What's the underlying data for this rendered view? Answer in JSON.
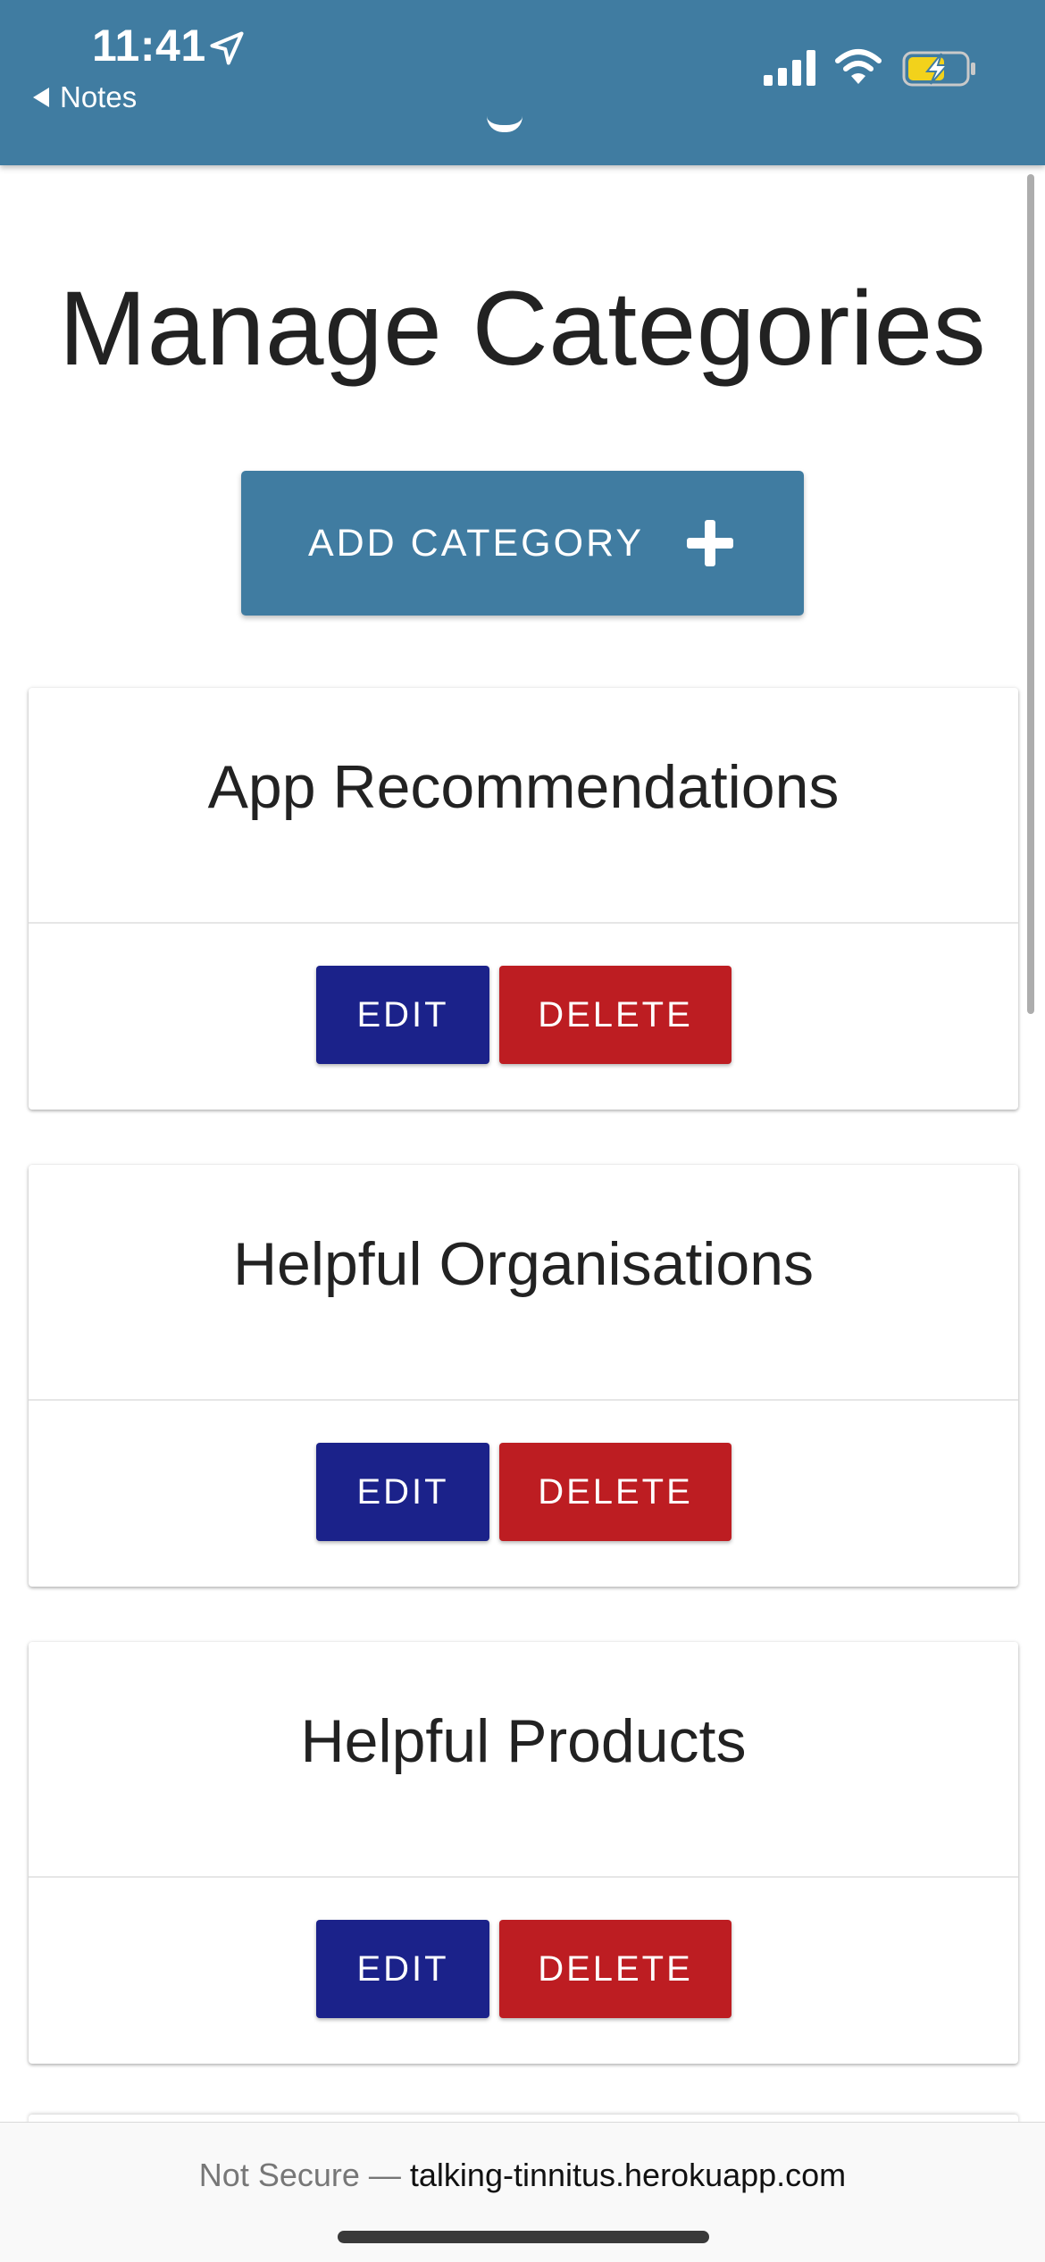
{
  "status_bar": {
    "time": "11:41",
    "back_app": "Notes",
    "icons": [
      "location-arrow-icon",
      "cellular-signal-icon",
      "wifi-icon",
      "battery-charging-icon"
    ]
  },
  "colors": {
    "header": "#407ca1",
    "add_button": "#407ca1",
    "edit_button": "#1b228a",
    "delete_button": "#bd1d22"
  },
  "page": {
    "title": "Manage Categories",
    "add_button_label": "ADD CATEGORY",
    "add_button_icon": "plus-icon"
  },
  "categories": [
    {
      "name": "App Recommendations",
      "edit_label": "EDIT",
      "delete_label": "DELETE"
    },
    {
      "name": "Helpful Organisations",
      "edit_label": "EDIT",
      "delete_label": "DELETE"
    },
    {
      "name": "Helpful Products",
      "edit_label": "EDIT",
      "delete_label": "DELETE"
    }
  ],
  "browser": {
    "security_label": "Not Secure —",
    "domain": "talking-tinnitus.herokuapp.com"
  }
}
